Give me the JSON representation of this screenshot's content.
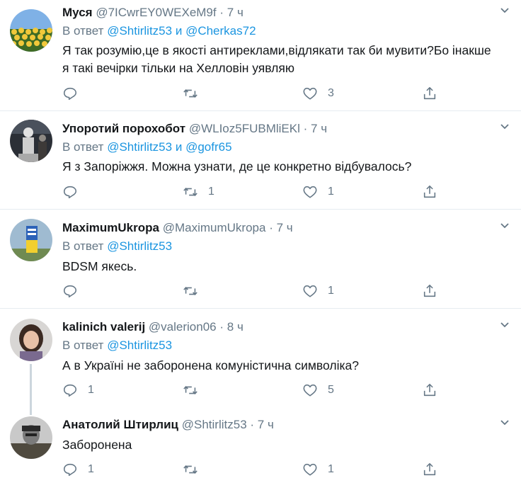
{
  "tweets": [
    {
      "name": "Муся",
      "handle": "@7ICwrEY0WEXeM9f",
      "time": "7 ч",
      "reply_prefix": "В ответ",
      "mentions": [
        "@Shtirlitz53",
        "@Cherkas72"
      ],
      "conjunction": "и",
      "text_lines": [
        "Я так розумію,це в якості антиреклами,відлякати так би мувити?Бо інакше",
        "я такі вечірки тільки на Хелловін уявляю"
      ],
      "reply_count": "",
      "retweet_count": "",
      "like_count": "3"
    },
    {
      "name": "Упоротий порохобот",
      "handle": "@WLIoz5FUBMliEKl",
      "time": "7 ч",
      "reply_prefix": "В ответ",
      "mentions": [
        "@Shtirlitz53",
        "@gofr65"
      ],
      "conjunction": "и",
      "text_lines": [
        "Я з Запоріжжя. Можна узнати, де це конкретно відбувалось?"
      ],
      "reply_count": "",
      "retweet_count": "1",
      "like_count": "1"
    },
    {
      "name": "MaximumUkropa",
      "handle": "@MaximumUkropa",
      "time": "7 ч",
      "reply_prefix": "В ответ",
      "mentions": [
        "@Shtirlitz53"
      ],
      "conjunction": "",
      "text_lines": [
        "BDSM якесь."
      ],
      "reply_count": "",
      "retweet_count": "",
      "like_count": "1"
    },
    {
      "name": "kalinich valerij",
      "handle": "@valerion06",
      "time": "8 ч",
      "reply_prefix": "В ответ",
      "mentions": [
        "@Shtirlitz53"
      ],
      "conjunction": "",
      "text_lines": [
        "А в Україні не заборонена комуністична символіка?"
      ],
      "reply_count": "1",
      "retweet_count": "",
      "like_count": "5"
    },
    {
      "name": "Анатолий Штирлиц",
      "handle": "@Shtirlitz53",
      "time": "7 ч",
      "text_lines": [
        "Заборонена"
      ],
      "reply_count": "1",
      "retweet_count": "",
      "like_count": "1"
    }
  ],
  "dot": "·",
  "icons": {
    "reply": "reply-icon",
    "retweet": "retweet-icon",
    "like": "like-icon",
    "share": "share-icon",
    "caret": "chevron-down-icon"
  },
  "colors": {
    "mention": "#1b95e0",
    "muted": "#657786",
    "border": "#e6ecf0"
  }
}
